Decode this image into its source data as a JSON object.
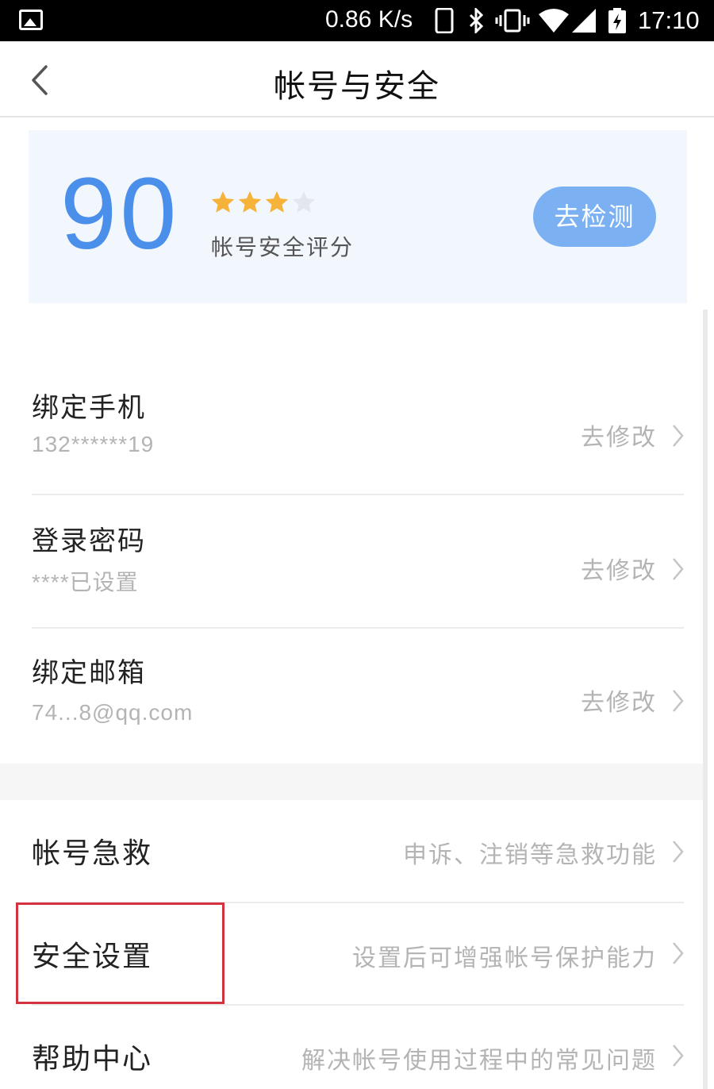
{
  "status_bar": {
    "speed": "0.86 K/s",
    "time": "17:10",
    "icons": [
      "gallery-icon",
      "phone-icon",
      "bluetooth-icon",
      "vibrate-icon",
      "wifi-icon",
      "signal-icon",
      "battery-icon"
    ]
  },
  "header": {
    "title": "帐号与安全",
    "back_icon": "chevron-left-icon"
  },
  "score_card": {
    "score": "90",
    "stars_filled": 3,
    "stars_total": 4,
    "label": "帐号安全评分",
    "detect_button": "去检测",
    "accent_color": "#4a8fea",
    "star_color": "#f5b33a"
  },
  "account_items": [
    {
      "title": "绑定手机",
      "value": "132******19",
      "action": "去修改"
    },
    {
      "title": "登录密码",
      "value": "****已设置",
      "action": "去修改"
    },
    {
      "title": "绑定邮箱",
      "value": "74...8@qq.com",
      "action": "去修改"
    }
  ],
  "more_items": [
    {
      "title": "帐号急救",
      "hint": "申诉、注销等急救功能"
    },
    {
      "title": "安全设置",
      "hint": "设置后可增强帐号保护能力"
    },
    {
      "title": "帮助中心",
      "hint": "解决帐号使用过程中的常见问题"
    }
  ],
  "highlight_color": "#d3333f"
}
